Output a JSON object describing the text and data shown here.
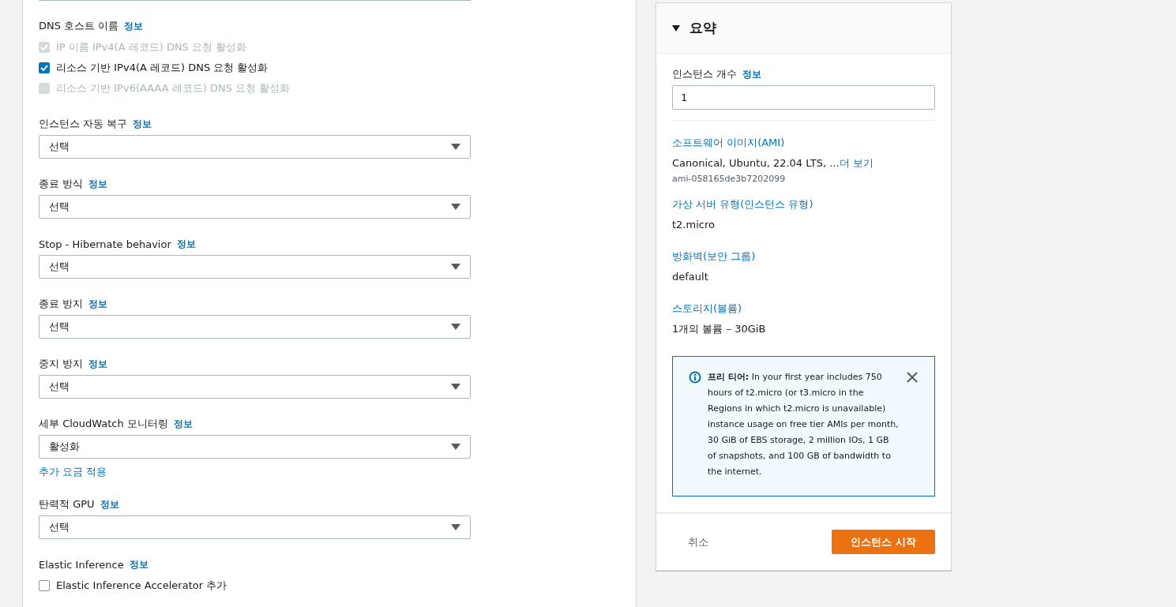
{
  "form": {
    "fields": [
      {
        "kind": "checkbox-group",
        "label": "DNS 호스트 이름",
        "info": "정보",
        "options": [
          {
            "label": "IP 이름 IPv4(A 레코드) DNS 요청 활성화",
            "checked": true,
            "disabled": true
          },
          {
            "label": "리소스 기반 IPv4(A 레코드) DNS 요청 활성화",
            "checked": true,
            "disabled": false
          },
          {
            "label": "리소스 기반 IPv6(AAAA 레코드) DNS 요청 활성화",
            "checked": false,
            "disabled": true
          }
        ]
      },
      {
        "kind": "select",
        "label": "인스턴스 자동 복구",
        "info": "정보",
        "value": "선택"
      },
      {
        "kind": "select",
        "label": "종료 방식",
        "info": "정보",
        "value": "선택"
      },
      {
        "kind": "select",
        "label": "Stop - Hibernate behavior",
        "info": "정보",
        "value": "선택"
      },
      {
        "kind": "select",
        "label": "종료 방지",
        "info": "정보",
        "value": "선택"
      },
      {
        "kind": "select",
        "label": "중지 방지",
        "info": "정보",
        "value": "선택"
      },
      {
        "kind": "select",
        "label": "세부 CloudWatch 모니터링",
        "info": "정보",
        "value": "활성화",
        "note": "추가 요금 적용"
      },
      {
        "kind": "select",
        "label": "탄력적 GPU",
        "info": "정보",
        "value": "선택"
      },
      {
        "kind": "checkbox-group",
        "label": "Elastic Inference",
        "info": "정보",
        "options": [
          {
            "label": "Elastic Inference Accelerator 추가",
            "checked": false,
            "disabled": false
          }
        ]
      }
    ]
  },
  "summary": {
    "title": "요약",
    "expanded": true,
    "count": {
      "label": "인스턴스 개수",
      "info": "정보",
      "value": "1"
    },
    "sections": [
      {
        "title": "소프트웨어 이미지(AMI)",
        "value": "Canonical, Ubuntu, 22.04 LTS, ...",
        "more": "더 보기",
        "sub": "ami-058165de3b7202099"
      },
      {
        "title": "가상 서버 유형(인스턴스 유형)",
        "value": "t2.micro"
      },
      {
        "title": "방화벽(보안 그룹)",
        "value": "default"
      },
      {
        "title": "스토리지(볼륨)",
        "value": "1개의 볼륨 – 30GiB"
      }
    ],
    "notice": "**프리 티어:** In your first year includes 750 hours of t2.micro (or t3.micro in the Regions in which t2.micro is unavailable) instance usage on free tier AMIs per month, 30 GiB of EBS storage, 2 million IOs, 1 GB of snapshots, and 100 GB of bandwidth to the internet.",
    "cancel": "취소",
    "launch": "인스턴스 시작"
  }
}
